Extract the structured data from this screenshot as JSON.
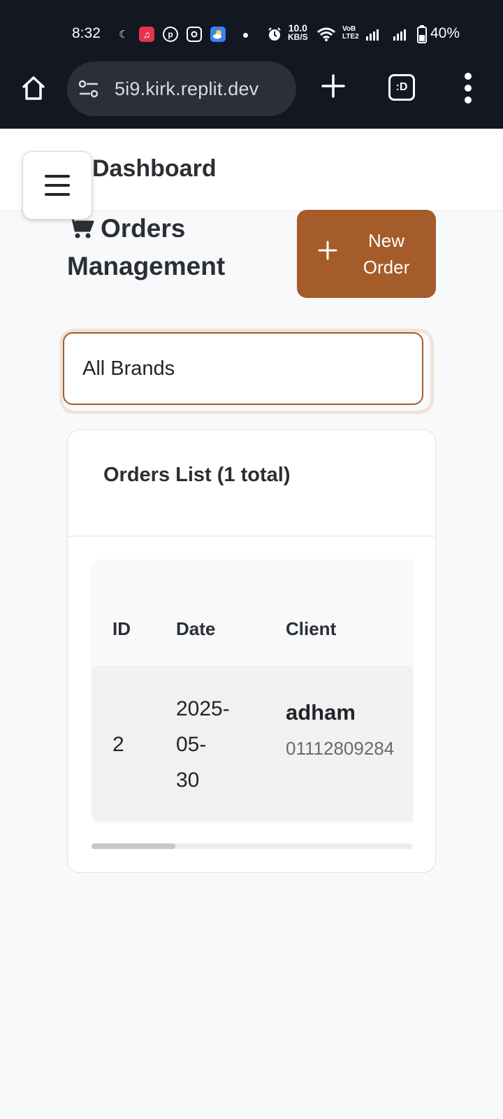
{
  "status_bar": {
    "time": "8:32",
    "speed_value": "10.0",
    "speed_unit": "KB/S",
    "volte_top": "VoB",
    "volte_bottom": "LTE2",
    "battery": "40%",
    "notification_icons": [
      "ramadan-icon",
      "music-icon",
      "pinterest-icon",
      "instagram-icon",
      "weather-icon"
    ]
  },
  "browser": {
    "url": "5i9.kirk.replit.dev",
    "tab_label": ":D"
  },
  "header": {
    "title": "Dashboard"
  },
  "page": {
    "title_line1": "Orders",
    "title_line2": "Management",
    "new_order_line1": "New",
    "new_order_line2": "Order",
    "accent_color": "#a45c2a"
  },
  "filter": {
    "brand_selected": "All Brands"
  },
  "orders": {
    "card_title": "Orders List (1 total)",
    "columns": [
      "ID",
      "Date",
      "Client"
    ],
    "rows": [
      {
        "id": "2",
        "date_line1": "2025-",
        "date_line2": "05-",
        "date_line3": "30",
        "client_name": "adham",
        "client_phone": "01112809284"
      }
    ],
    "scroll_position": 0.26
  }
}
